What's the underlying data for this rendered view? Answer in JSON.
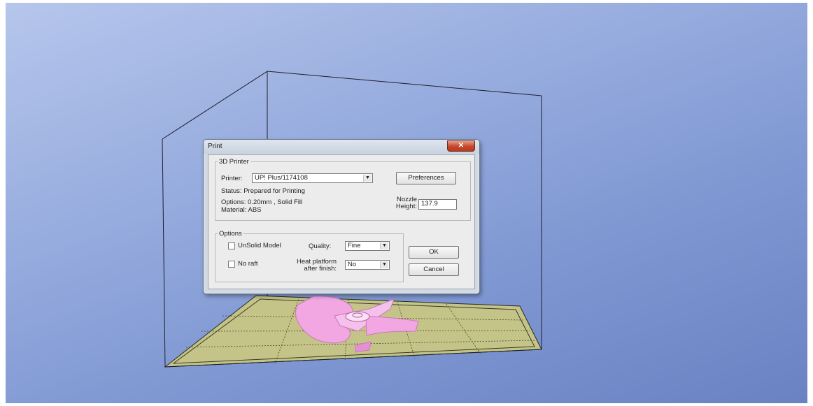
{
  "dialog": {
    "title": "Print",
    "close_glyph": "✕",
    "printer_group": {
      "legend": "3D Printer",
      "printer_label": "Printer:",
      "printer_value": "UP! Plus/1174108",
      "preferences_button": "Preferences",
      "status": "Status: Prepared for Printing",
      "options_line": "Options: 0.20mm , Solid Fill",
      "material_line": "Material: ABS",
      "nozzle_label_1": "Nozzle",
      "nozzle_label_2": "Height:",
      "nozzle_value": "137.9"
    },
    "options_group": {
      "legend": "Options",
      "unsolid_label": "UnSolid Model",
      "unsolid_checked": false,
      "noraft_label": "No raft",
      "noraft_checked": false,
      "quality_label": "Quality:",
      "quality_value": "Fine",
      "heat_label_1": "Heat platform",
      "heat_label_2": "after finish:",
      "heat_value": "No"
    },
    "ok_button": "OK",
    "cancel_button": "Cancel"
  },
  "scene": {
    "background_color": "#8ea3da",
    "platform_color": "#c4c489",
    "model_color": "#f2a6e2",
    "box_line_color": "#1e1e2a"
  },
  "icons": {
    "close": "close-icon",
    "dropdown": "chevron-down-icon"
  }
}
